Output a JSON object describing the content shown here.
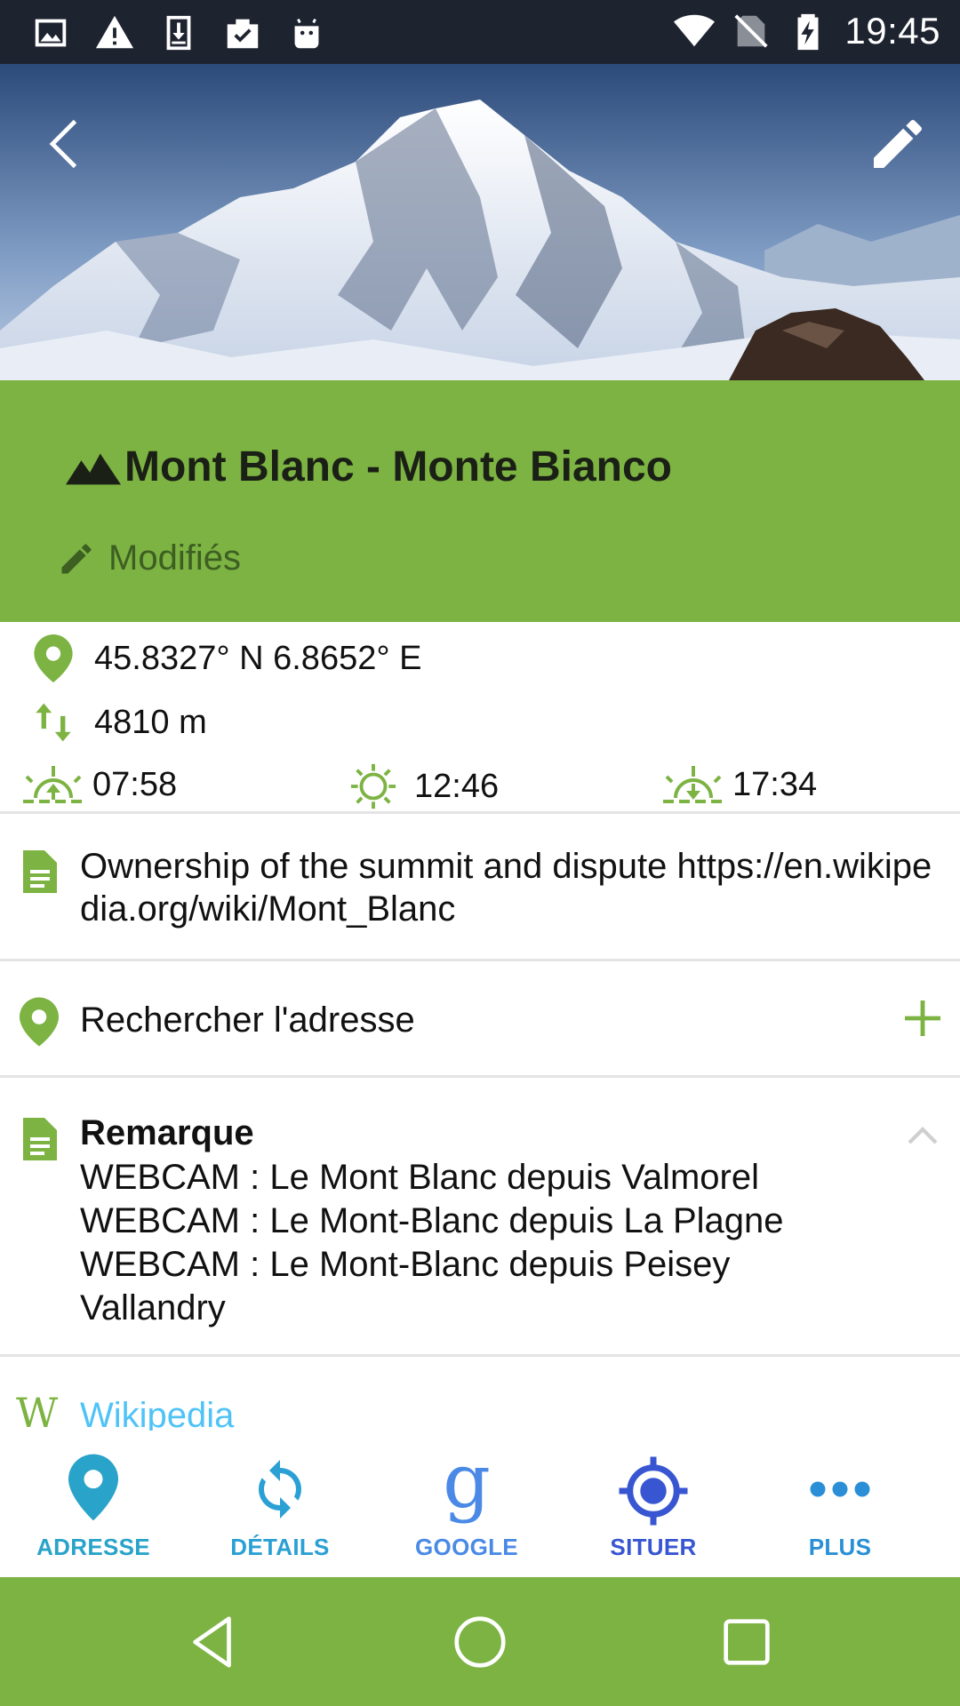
{
  "status_bar": {
    "time": "19:45",
    "left_icons": [
      "image-icon",
      "warning-icon",
      "download-icon",
      "clipboard-check-icon",
      "android-icon"
    ],
    "right_icons": [
      "wifi-icon",
      "no-sim-icon",
      "battery-charging-icon"
    ]
  },
  "header": {
    "back_icon": "chevron-left-icon",
    "edit_icon": "pencil-icon"
  },
  "place": {
    "title": "Mont Blanc - Monte Bianco",
    "title_icon": "mountain-icon",
    "modified_label": "Modifiés",
    "coordinates": "45.8327° N 6.8652° E",
    "elevation": "4810 m",
    "sunrise": "07:58",
    "solar_noon": "12:46",
    "sunset": "17:34"
  },
  "description": {
    "text": "Ownership of the summit and dispute https://en.wikipedia.org/wiki/Mont_Blanc"
  },
  "address": {
    "label": "Rechercher l'adresse"
  },
  "remark": {
    "title": "Remarque",
    "lines": [
      "WEBCAM : Le Mont Blanc depuis Valmorel",
      "WEBCAM : Le Mont-Blanc depuis La Plagne",
      "WEBCAM : Le Mont-Blanc depuis Peisey Vallandry"
    ]
  },
  "wikipedia": {
    "icon_letter": "W",
    "label": "Wikipedia"
  },
  "actions": [
    {
      "label": "ADRESSE",
      "icon": "map-pin-icon",
      "color": "#29a3c9"
    },
    {
      "label": "DÉTAILS",
      "icon": "refresh-icon",
      "color": "#2ba0d4"
    },
    {
      "label": "GOOGLE",
      "icon": "google-icon",
      "color": "#4a8ae6"
    },
    {
      "label": "SITUER",
      "icon": "crosshair-icon",
      "color": "#3856d1"
    },
    {
      "label": "PLUS",
      "icon": "more-icon",
      "color": "#2a8fd6"
    }
  ],
  "colors": {
    "accent_green": "#7cb342",
    "status_bar": "#1e2330",
    "link_blue": "#4fc3f7"
  }
}
